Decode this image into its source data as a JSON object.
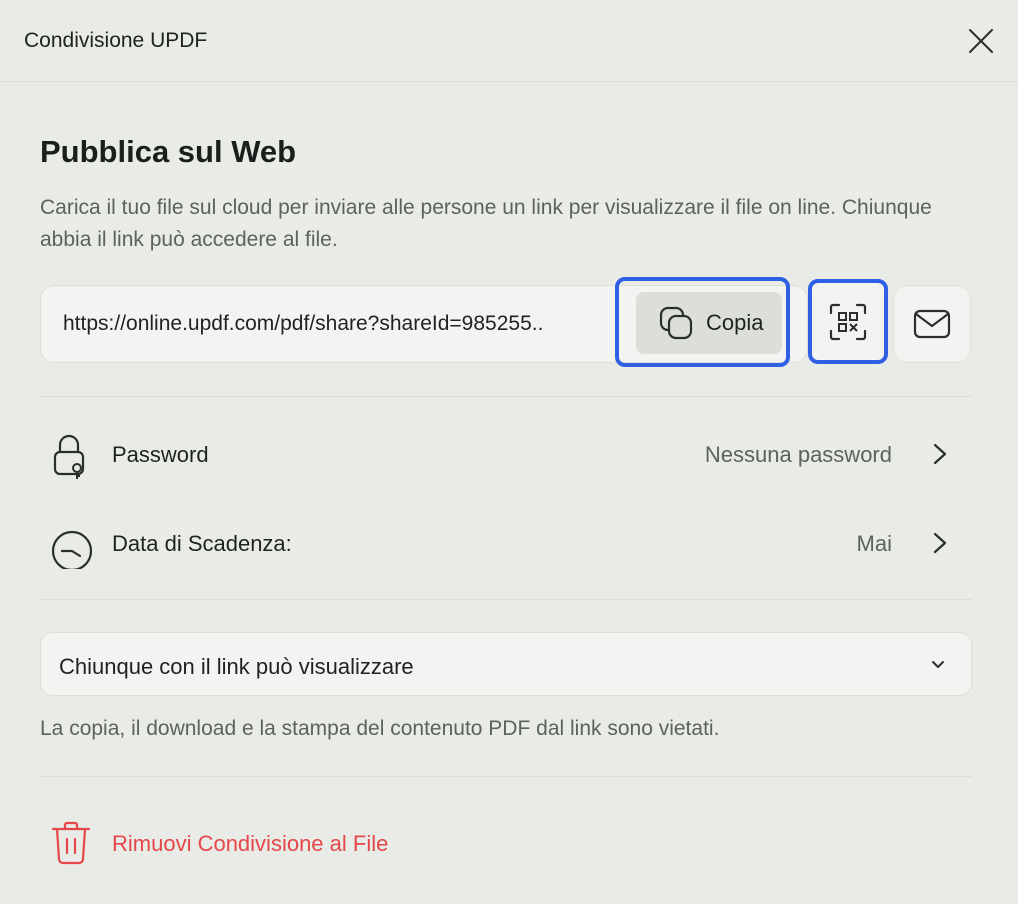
{
  "window": {
    "title": "Condivisione UPDF"
  },
  "publish": {
    "heading": "Pubblica sul Web",
    "description": "Carica il tuo file sul cloud per inviare alle persone un link per visualizzare il file on line. Chiunque abbia il link può accedere al file."
  },
  "link": {
    "url": "https://online.updf.com/pdf/share?shareId=985255..",
    "copy_label": "Copia"
  },
  "settings": {
    "password": {
      "label": "Password",
      "value": "Nessuna password"
    },
    "expiry": {
      "label": "Data di Scadenza:",
      "value": "Mai"
    }
  },
  "permission": {
    "selected": "Chiunque con il link può visualizzare",
    "note": "La copia, il download e la stampa del contenuto PDF dal link sono vietati."
  },
  "remove": {
    "label": "Rimuovi Condivisione al File"
  },
  "colors": {
    "accent_highlight": "#2f5fe3",
    "danger": "#e5474a",
    "background": "#e9ebe6"
  },
  "icons": [
    "close-icon",
    "copy-icon",
    "qr-code-icon",
    "mail-icon",
    "lock-icon",
    "clock-icon",
    "chevron-right-icon",
    "chevron-down-icon",
    "trash-icon"
  ]
}
